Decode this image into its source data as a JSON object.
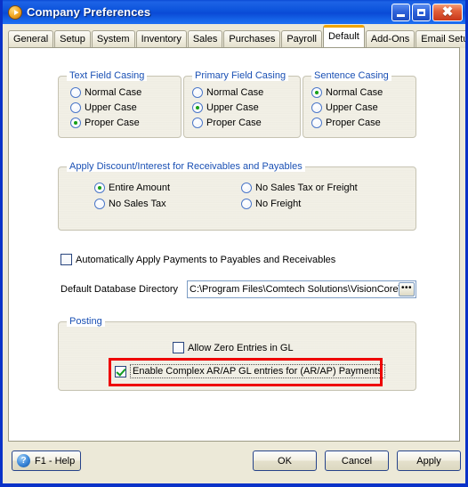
{
  "window": {
    "title": "Company Preferences",
    "icon": "play-circle-icon",
    "minimize_label": "Minimize",
    "maximize_label": "Maximize",
    "close_label": "Close",
    "frame_color": "#0a32c8",
    "titlebar_color": "#0e55dd"
  },
  "tabs": [
    {
      "label": "General",
      "active": false
    },
    {
      "label": "Setup",
      "active": false
    },
    {
      "label": "System",
      "active": false
    },
    {
      "label": "Inventory",
      "active": false
    },
    {
      "label": "Sales",
      "active": false
    },
    {
      "label": "Purchases",
      "active": false
    },
    {
      "label": "Payroll",
      "active": false
    },
    {
      "label": "Default",
      "active": true
    },
    {
      "label": "Add-Ons",
      "active": false
    },
    {
      "label": "Email Setup",
      "active": false
    }
  ],
  "active_tab_accent": "#f0a400",
  "groups": {
    "text_field_casing": {
      "title": "Text Field Casing",
      "options": [
        {
          "label": "Normal Case",
          "selected": false
        },
        {
          "label": "Upper Case",
          "selected": false
        },
        {
          "label": "Proper Case",
          "selected": true
        }
      ]
    },
    "primary_field_casing": {
      "title": "Primary Field Casing",
      "options": [
        {
          "label": "Normal Case",
          "selected": false
        },
        {
          "label": "Upper Case",
          "selected": true
        },
        {
          "label": "Proper Case",
          "selected": false
        }
      ]
    },
    "sentence_casing": {
      "title": "Sentence Casing",
      "options": [
        {
          "label": "Normal Case",
          "selected": true
        },
        {
          "label": "Upper Case",
          "selected": false
        },
        {
          "label": "Proper Case",
          "selected": false
        }
      ]
    },
    "apply_discount": {
      "title": "Apply Discount/Interest for Receivables and Payables",
      "options": [
        {
          "label": "Entire Amount",
          "selected": true
        },
        {
          "label": "No Sales Tax",
          "selected": false
        },
        {
          "label": "No Sales Tax or Freight",
          "selected": false
        },
        {
          "label": "No Freight",
          "selected": false
        }
      ]
    },
    "posting": {
      "title": "Posting",
      "allow_zero": {
        "label": "Allow Zero Entries in GL",
        "checked": false
      },
      "enable_complex": {
        "label": "Enable Complex AR/AP  GL entries for (AR/AP)  Payments",
        "checked": true,
        "focused": true
      }
    }
  },
  "auto_apply": {
    "label": "Automatically Apply Payments to Payables and Receivables",
    "checked": false
  },
  "database_directory": {
    "label": "Default Database Directory",
    "value": "C:\\Program Files\\Comtech Solutions\\VisionCore\\[",
    "browse_label": "•••"
  },
  "annotation": {
    "color": "#ee0000"
  },
  "footer": {
    "help": {
      "label": "F1 - Help",
      "icon": "question-mark-icon",
      "glyph": "?"
    },
    "ok": "OK",
    "cancel": "Cancel",
    "apply": "Apply"
  }
}
